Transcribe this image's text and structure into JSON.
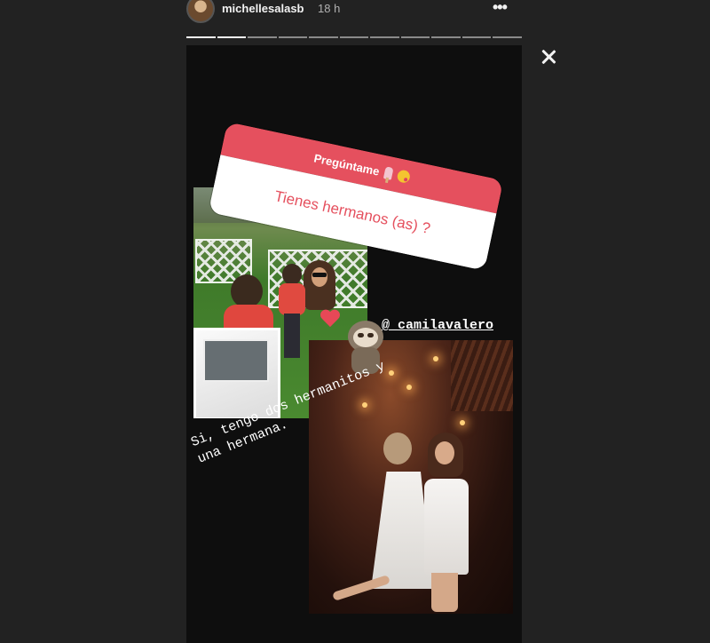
{
  "header": {
    "username": "michellesalasb",
    "time_ago": "18 h",
    "more_label": "•••",
    "progress_segments": 11,
    "progress_done": 2
  },
  "question_sticker": {
    "title": "Pregúntame",
    "question": "Tienes hermanos (as) ?"
  },
  "mention": "@_camilavalero",
  "caption": {
    "line1": "Si, tengo dos hermanitos y",
    "line2": "una hermana."
  },
  "icons": [
    "close-icon",
    "more-icon",
    "heart-icon",
    "sloth-sticker",
    "avatar"
  ],
  "colors": {
    "background": "#222222",
    "sticker_accent": "#e5505e"
  }
}
